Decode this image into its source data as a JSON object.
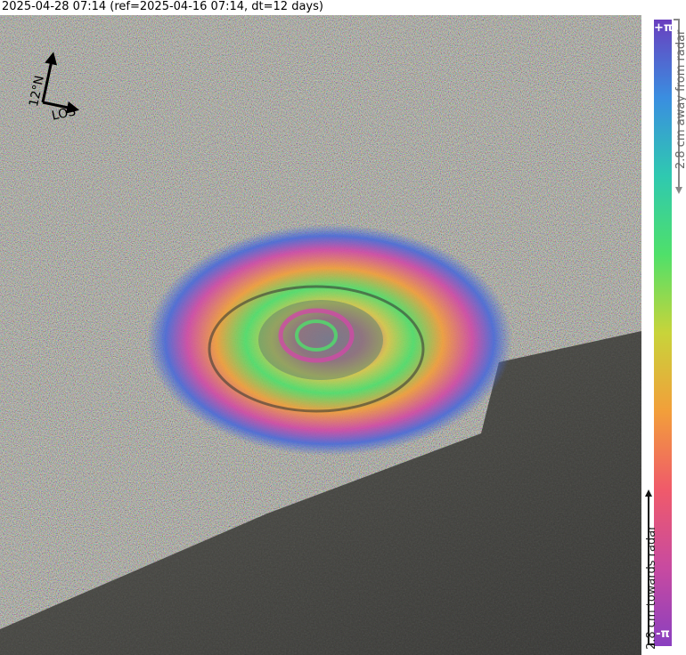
{
  "title": "2025-04-28 07:14 (ref=2025-04-16 07:14, dt=12 days)",
  "north_arrow": {
    "north_label": "12°N",
    "los_label": "LOS"
  },
  "colorbar": {
    "top_label": "+π",
    "bottom_label": "-π",
    "away_label": "2.8 cm away from radar",
    "towards_label": "2.8 cm towards radar",
    "colors": [
      "#6a3fbf",
      "#3a8ee0",
      "#2fc9b0",
      "#4fe06a",
      "#c8d43a",
      "#f29f3a",
      "#f05a6a",
      "#c84aa0",
      "#8a3fc0"
    ]
  },
  "image": {
    "description_colors": {
      "noise": "#8a8a78",
      "dark_terrain": "#3b3b38",
      "ring_magenta": "#d04aa6",
      "ring_blue": "#4a6ad8",
      "ring_green": "#5ad86a",
      "ring_yellow": "#d8c84a"
    }
  }
}
